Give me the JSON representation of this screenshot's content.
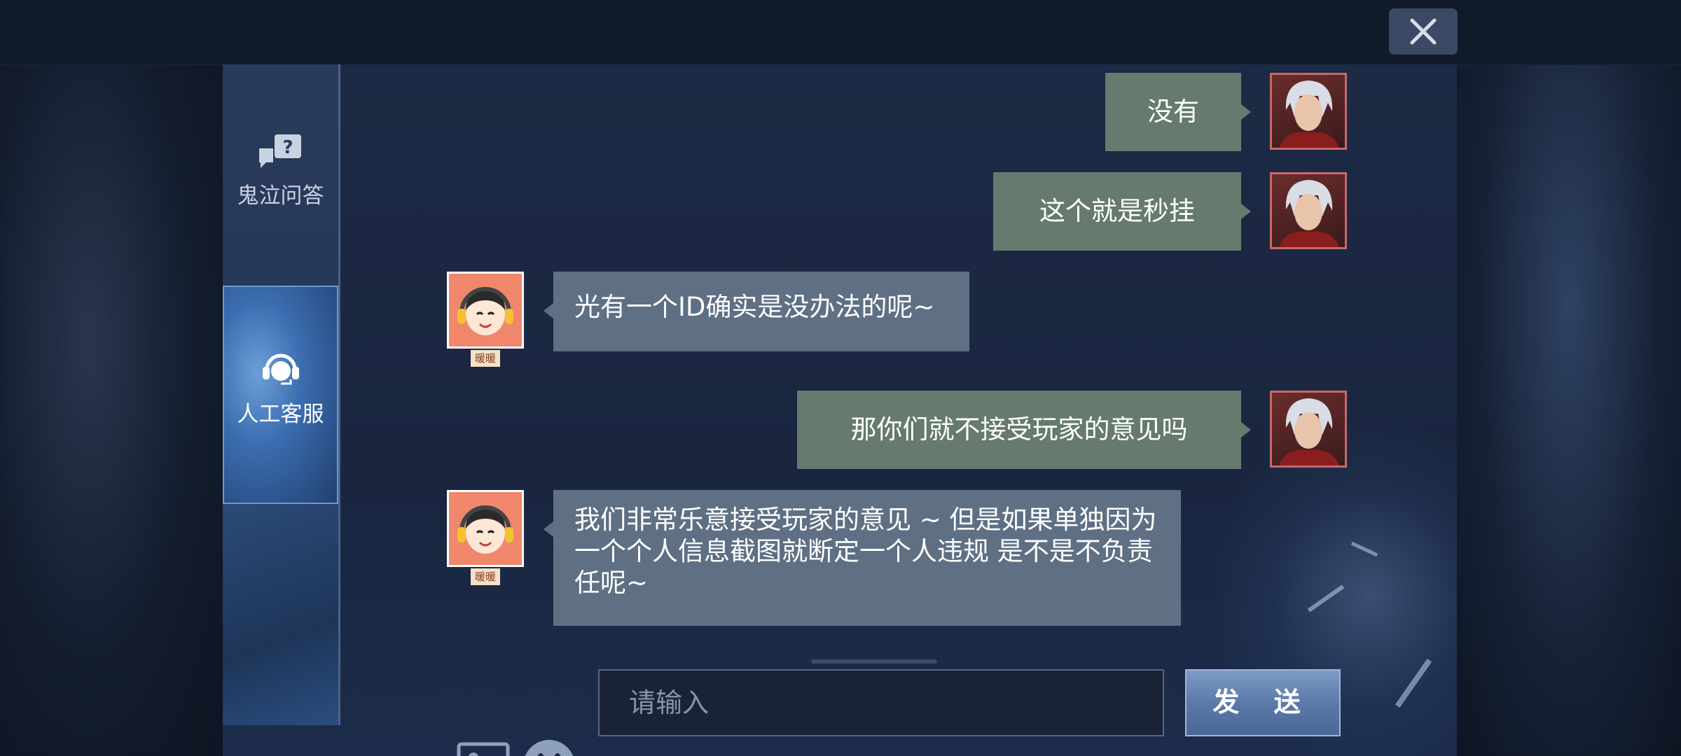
{
  "sidebar": {
    "items": [
      {
        "label": "鬼泣问答",
        "icon": "question-chat-icon"
      },
      {
        "label": "人工客服",
        "icon": "headset-icon"
      }
    ]
  },
  "messages": [
    {
      "from": "user",
      "text": "没有"
    },
    {
      "from": "user",
      "text": "这个就是秒挂"
    },
    {
      "from": "agent",
      "text": "光有一个ID确实是没办法的呢~",
      "name_tag": "暖暖"
    },
    {
      "from": "user",
      "text": "那你们就不接受玩家的意见吗"
    },
    {
      "from": "agent",
      "text": "我们非常乐意接受玩家的意见 ~  但是如果单独因为一个个人信息截图就断定一个人违规  是不是不负责任呢~",
      "name_tag": "暖暖"
    }
  ],
  "input": {
    "placeholder": "请输入"
  },
  "send_label": "发 送",
  "icons": {
    "close": "close-icon",
    "image": "image-icon",
    "emoji": "emoji-icon"
  },
  "colors": {
    "user_bubble": "#667a6e",
    "agent_bubble": "#5f6f84",
    "accent": "#5c7aa8"
  }
}
